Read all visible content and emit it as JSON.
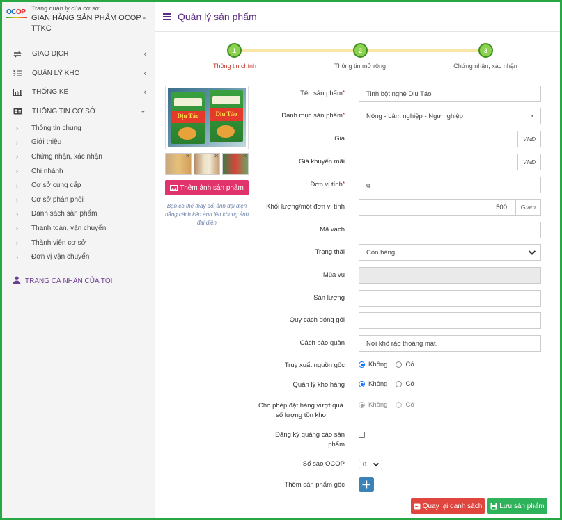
{
  "brand": {
    "subtitle": "Trang quản lý của cơ sở",
    "title": "GIAN HÀNG SẢN PHẨM OCOP - TTKC",
    "logo_text_1": "OC",
    "logo_text_2": "OP"
  },
  "sidebar": {
    "items": [
      {
        "label": "GIAO DỊCH",
        "icon": "swap-icon",
        "chevron": "‹"
      },
      {
        "label": "QUẢN LÝ KHO",
        "icon": "list-check-icon",
        "chevron": "‹"
      },
      {
        "label": "THỐNG KÊ",
        "icon": "bar-chart-icon",
        "chevron": "‹"
      },
      {
        "label": "THÔNG TIN CƠ SỞ",
        "icon": "id-card-icon",
        "chevron": "⌄"
      }
    ],
    "sub_items": [
      "Thông tin chung",
      "Giới thiệu",
      "Chứng nhận, xác nhận",
      "Chi nhánh",
      "Cơ sở cung cấp",
      "Cơ sở phân phối",
      "Danh sách sản phẩm",
      "Thanh toán, vận chuyển",
      "Thành viên cơ sở",
      "Đơn vị vận chuyển"
    ],
    "profile": "TRANG CÁ NHÂN CỦA TÔI"
  },
  "header": {
    "title": "Quản lý sản phẩm"
  },
  "stepper": {
    "steps": [
      {
        "num": "1",
        "label": "Thông tin chính",
        "active": true
      },
      {
        "num": "2",
        "label": "Thông tin mở rộng",
        "active": false
      },
      {
        "num": "3",
        "label": "Chứng nhận, xác nhận",
        "active": false
      }
    ]
  },
  "image_panel": {
    "product_name_on_pack": "Dịu Táo",
    "add_button": "Thêm ảnh sản phẩm",
    "hint": "Bạn có thể thay đổi ảnh đại diện bằng cách kéo ảnh lên khung ảnh đại diện"
  },
  "form": {
    "name": {
      "label": "Tên sản phẩm",
      "value": "Tinh bột nghệ Dịu Táo",
      "required": "*"
    },
    "category": {
      "label": "Danh mục sản phẩm",
      "value": "Nông - Lâm nghiệp - Ngư nghiệp",
      "required": "*"
    },
    "price": {
      "label": "Giá",
      "value": "",
      "unit": "VNĐ"
    },
    "promo_price": {
      "label": "Giá khuyến mãi",
      "value": "",
      "unit": "VNĐ"
    },
    "unit": {
      "label": "Đơn vị tính",
      "value": "g",
      "required": "*"
    },
    "weight": {
      "label": "Khối lượng/một đơn vị tính",
      "value": "500",
      "unit": "Gram"
    },
    "barcode": {
      "label": "Mã vạch",
      "value": ""
    },
    "status": {
      "label": "Trạng thái",
      "value": "Còn hàng"
    },
    "season": {
      "label": "Mùa vụ",
      "value": ""
    },
    "output": {
      "label": "Sản lượng",
      "value": ""
    },
    "packing": {
      "label": "Quy cách đóng gói",
      "value": ""
    },
    "storage": {
      "label": "Cách bảo quản",
      "value": "Nơi khô ráo thoáng mát."
    },
    "traceability": {
      "label": "Truy xuất nguồn gốc",
      "options": [
        "Không",
        "Có"
      ],
      "selected": "Không"
    },
    "inventory": {
      "label": "Quản lý kho hàng",
      "options": [
        "Không",
        "Có"
      ],
      "selected": "Không"
    },
    "overorder": {
      "label": "Cho phép đặt hàng vượt quá số lượng tồn kho",
      "options": [
        "Không",
        "Có"
      ],
      "selected": "Không",
      "disabled": true
    },
    "ads": {
      "label": "Đăng ký quảng cáo sản phẩm",
      "checked": false
    },
    "stars": {
      "label": "Số sao OCOP",
      "value": "0"
    },
    "origin_product": {
      "label": "Thêm sản phẩm gốc"
    }
  },
  "buttons": {
    "back": "Quay lại danh sách",
    "save": "Lưu sản phẩm"
  }
}
